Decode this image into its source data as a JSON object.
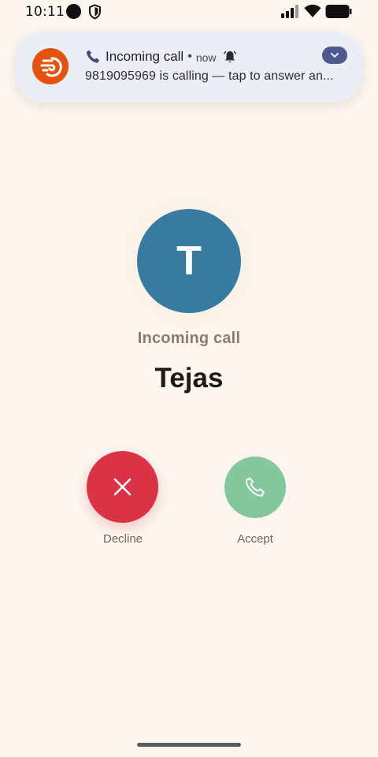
{
  "status_bar": {
    "time": "10:11"
  },
  "notification": {
    "title": "Incoming call",
    "separator": "•",
    "time": "now",
    "body": "9819095969 is calling — tap to answer an...",
    "app_icon": "call-app-icon",
    "accent_color": "#e4520f"
  },
  "caller": {
    "avatar_letter": "T",
    "avatar_color": "#367a9f",
    "status": "Incoming call",
    "name": "Tejas"
  },
  "actions": {
    "decline_label": "Decline",
    "decline_color": "#d93345",
    "accept_label": "Accept",
    "accept_color": "#83c79d"
  }
}
